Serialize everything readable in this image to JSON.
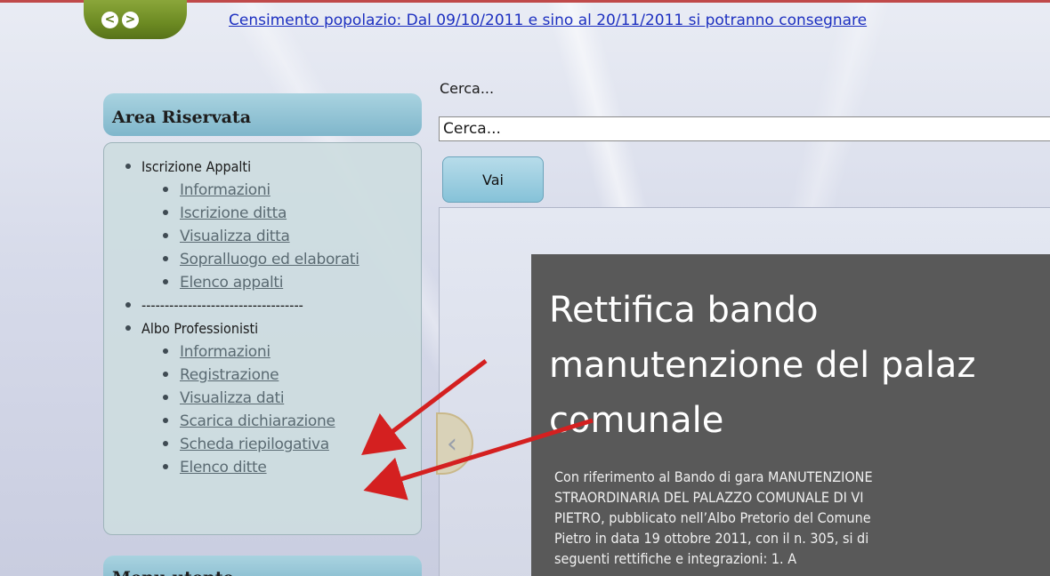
{
  "ticker": {
    "text": "Censimento popolazio: Dal 09/10/2011 e sino al 20/11/2011 si potranno consegnare"
  },
  "nav": {
    "prev_label": "<",
    "next_label": ">"
  },
  "sidebar": {
    "title": "Area Riservata",
    "sections": [
      {
        "label": "Iscrizione Appalti",
        "items": [
          "Informazioni",
          "Iscrizione ditta",
          "Visualizza ditta",
          "Sopralluogo ed elaborati",
          "Elenco appalti"
        ]
      },
      {
        "label": "-----------------------------------",
        "items": []
      },
      {
        "label": "Albo Professionisti",
        "items": [
          "Informazioni",
          "Registrazione",
          "Visualizza dati",
          "Scarica dichiarazione",
          "Scheda riepilogativa",
          "Elenco ditte"
        ]
      }
    ],
    "next_title": "Menu utente"
  },
  "search": {
    "label": "Cerca...",
    "value": "Cerca...",
    "button_label": "Vai"
  },
  "slideshow": {
    "prev_icon": "chevron-left-icon",
    "prev_glyph": "‹",
    "title": " Rettifica bando\nmanutenzione del palaz\ncomunale",
    "text": "Con riferimento al Bando di gara MANUTENZIONE\nSTRAORDINARIA DEL PALAZZO COMUNALE DI VI\nPIETRO, pubblicato nell’Albo Pretorio del Comune\nPietro in data 19 ottobre 2011, con il n. 305, si di\nseguenti rettifiche e integrazioni:   1.   A"
  },
  "colors": {
    "ticker_link": "#1c2fc0",
    "nav_green": "#6c8a22",
    "panel_head": "#7fb6cb",
    "slide_bg": "#595959",
    "annotation_arrow": "#d42020"
  }
}
